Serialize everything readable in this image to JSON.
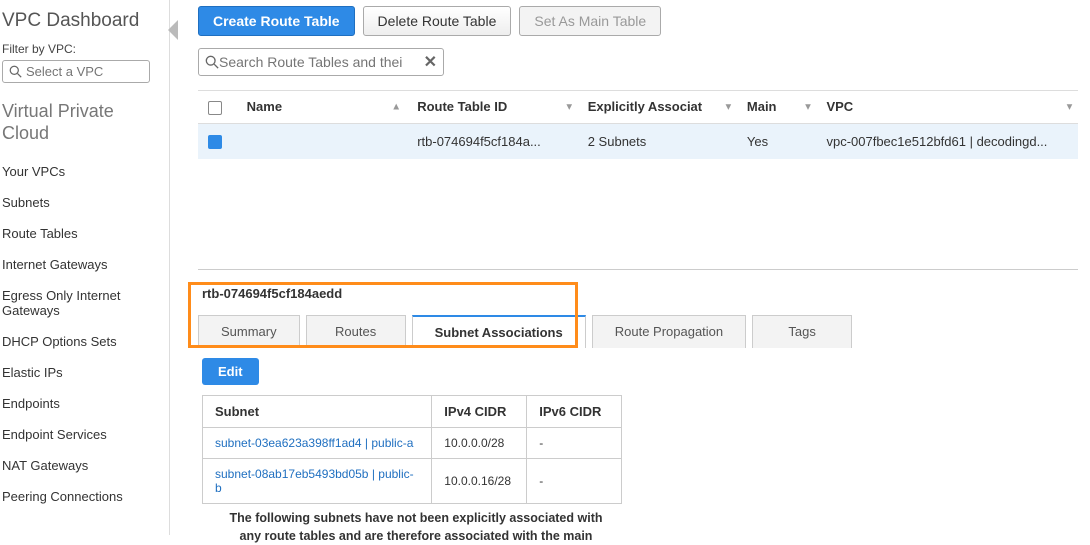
{
  "sidebar": {
    "title": "VPC Dashboard",
    "filter_label": "Filter by VPC:",
    "filter_placeholder": "Select a VPC",
    "section": "Virtual Private Cloud",
    "items": [
      "Your VPCs",
      "Subnets",
      "Route Tables",
      "Internet Gateways",
      "Egress Only Internet Gateways",
      "DHCP Options Sets",
      "Elastic IPs",
      "Endpoints",
      "Endpoint Services",
      "NAT Gateways",
      "Peering Connections"
    ]
  },
  "toolbar": {
    "create": "Create Route Table",
    "delete": "Delete Route Table",
    "set_main": "Set As Main Table"
  },
  "search": {
    "placeholder": "Search Route Tables and thei"
  },
  "table": {
    "headers": {
      "name": "Name",
      "rtid": "Route Table ID",
      "assoc": "Explicitly Associat",
      "main": "Main",
      "vpc": "VPC"
    },
    "row": {
      "name": "",
      "rtid": "rtb-074694f5cf184a...",
      "assoc": "2 Subnets",
      "main": "Yes",
      "vpc": "vpc-007fbec1e512bfd61 | decodingd..."
    }
  },
  "detail": {
    "id": "rtb-074694f5cf184aedd",
    "tabs": [
      "Summary",
      "Routes",
      "Subnet Associations",
      "Route Propagation",
      "Tags"
    ],
    "active_tab": 2,
    "edit": "Edit",
    "assoc_headers": {
      "subnet": "Subnet",
      "ipv4": "IPv4 CIDR",
      "ipv6": "IPv6 CIDR"
    },
    "assoc_rows": [
      {
        "subnet": "subnet-03ea623a398ff1ad4 | public-a",
        "ipv4": "10.0.0.0/28",
        "ipv6": "-"
      },
      {
        "subnet": "subnet-08ab17eb5493bd05b | public-b",
        "ipv4": "10.0.0.16/28",
        "ipv6": "-"
      }
    ],
    "note_l1": "The following subnets have not been explicitly associated with",
    "note_l2": "any route tables and are therefore associated with the main"
  }
}
